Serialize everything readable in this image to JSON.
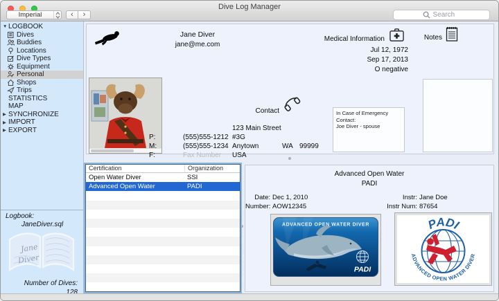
{
  "window": {
    "title": "Dive Log Manager"
  },
  "toolbar": {
    "units_value": "Imperial",
    "search_placeholder": "Search"
  },
  "colors": {
    "selection_blue": "#2268d2",
    "sidebar_blue": "#d4e8fc",
    "padi_blue": "#1e5fa8",
    "padi_red": "#cf2030",
    "traffic_red": "#fc5b57",
    "traffic_yellow": "#fdbe3f",
    "traffic_green": "#33c748"
  },
  "sidebar": {
    "items": [
      {
        "label": "LOGBOOK",
        "level": 0,
        "disclosure": "expanded",
        "icon": null,
        "selected": false
      },
      {
        "label": "Dives",
        "level": 1,
        "icon": "dives-icon",
        "selected": false
      },
      {
        "label": "Buddies",
        "level": 1,
        "icon": "buddies-icon",
        "selected": false
      },
      {
        "label": "Locations",
        "level": 1,
        "icon": "locations-icon",
        "selected": false
      },
      {
        "label": "Dive Types",
        "level": 1,
        "icon": "dive-types-icon",
        "selected": false
      },
      {
        "label": "Equipment",
        "level": 1,
        "icon": "equipment-icon",
        "selected": false
      },
      {
        "label": "Personal",
        "level": 1,
        "icon": "personal-icon",
        "selected": true
      },
      {
        "label": "Shops",
        "level": 1,
        "icon": "shops-icon",
        "selected": false
      },
      {
        "label": "Trips",
        "level": 1,
        "icon": "trips-icon",
        "selected": false
      },
      {
        "label": "STATISTICS",
        "level": 0,
        "icon": null,
        "selected": false
      },
      {
        "label": "MAP",
        "level": 0,
        "icon": null,
        "selected": false
      },
      {
        "label": "SYNCHRONIZE",
        "level": 0,
        "disclosure": "collapsed",
        "icon": null,
        "selected": false
      },
      {
        "label": "IMPORT",
        "level": 0,
        "disclosure": "collapsed",
        "icon": null,
        "selected": false
      },
      {
        "label": "EXPORT",
        "level": 0,
        "disclosure": "collapsed",
        "icon": null,
        "selected": false
      }
    ],
    "logbook_label": "Logbook:",
    "logbook_file": "JaneDiver.sql",
    "signature_line1": "Jane",
    "signature_line2": "Diver",
    "dives_label": "Number of Dives:",
    "dives_count": "128"
  },
  "personal": {
    "name": "Jane Diver",
    "email": "jane@me.com",
    "medical": {
      "label": "Medical Information",
      "birth_date": "Jul 12, 1972",
      "exam_date": "Sep 17, 2013",
      "blood_type": "O negative"
    },
    "notes_label": "Notes",
    "contact": {
      "label": "Contact",
      "address_line1": "123 Main Street",
      "address_line2": "#3G",
      "city": "Anytown",
      "state": "WA",
      "zip": "99999",
      "country": "USA",
      "phone_label": "P:",
      "phone": "(555)555-1212",
      "mobile_label": "M:",
      "mobile": "(555)555-1234",
      "fax_label": "F:",
      "fax_placeholder": "Fax Number"
    },
    "emergency": {
      "line1": "In Case of Emergency Contact:",
      "line2": "Joe Diver - spouse"
    }
  },
  "certifications": {
    "columns": [
      "Certification",
      "Organization"
    ],
    "rows": [
      {
        "certification": "Open Water Diver",
        "organization": "SSI",
        "selected": false
      },
      {
        "certification": "Advanced Open Water",
        "organization": "PADI",
        "selected": true
      }
    ],
    "empty_rows": 11
  },
  "certification_detail": {
    "title": "Advanced Open Water",
    "organization": "PADI",
    "date_label": "Date:",
    "date": "Dec 1, 2010",
    "number_label": "Number:",
    "number": "AOW12345",
    "instructor_label": "Instr:",
    "instructor": "Jane Doe",
    "instructor_num_label": "Instr Num:",
    "instructor_num": "87654",
    "card_front_title": "ADVANCED OPEN WATER DIVER",
    "card_front_brand": "PADI",
    "card_back_brand": "PADI",
    "card_back_ring_text": "ADVANCED OPEN WATER DIVER"
  }
}
